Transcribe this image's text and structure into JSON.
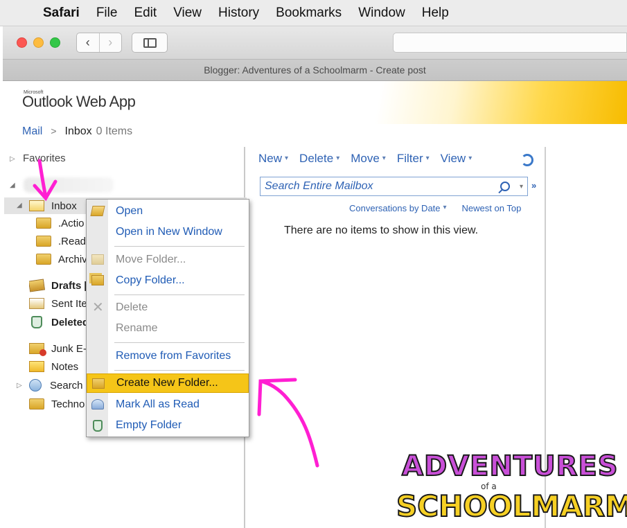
{
  "menubar": {
    "apple_icon": "apple-logo",
    "app": "Safari",
    "items": [
      "File",
      "Edit",
      "View",
      "History",
      "Bookmarks",
      "Window",
      "Help"
    ]
  },
  "browser": {
    "back_glyph": "‹",
    "forward_glyph": "›",
    "tab_title": "Blogger: Adventures of a Schoolmarm - Create post"
  },
  "owa": {
    "brand_small": "Microsoft",
    "title": "Outlook Web App",
    "header_gradient_color": "#f7bc00"
  },
  "breadcrumb": {
    "mail": "Mail",
    "separator": ">",
    "current": "Inbox",
    "count": "0 Items"
  },
  "navpane": {
    "favorites": "Favorites",
    "folders": [
      {
        "label": "Inbox",
        "icon": "inbox-icon"
      },
      {
        "label": ".Actio",
        "icon": "folder-icon"
      },
      {
        "label": ".Read",
        "icon": "folder-icon"
      },
      {
        "label": "Archiv",
        "icon": "folder-icon"
      },
      {
        "label": "Drafts [",
        "icon": "drafts-icon"
      },
      {
        "label": "Sent Ite",
        "icon": "sent-items-icon"
      },
      {
        "label": "Deleted",
        "icon": "deleted-items-icon"
      },
      {
        "label": "Junk E-",
        "icon": "junk-email-icon"
      },
      {
        "label": "Notes",
        "icon": "notes-icon"
      },
      {
        "label": "Search",
        "icon": "search-folder-icon"
      },
      {
        "label": "Techno",
        "icon": "folder-icon"
      }
    ]
  },
  "listpane": {
    "commands": [
      "New",
      "Delete",
      "Move",
      "Filter",
      "View"
    ],
    "search_placeholder": "Search Entire Mailbox",
    "sort_by": "Conversations by Date",
    "sort_order": "Newest on Top",
    "empty_message": "There are no items to show in this view."
  },
  "context_menu": {
    "items": [
      {
        "label": "Open",
        "enabled": true
      },
      {
        "label": "Open in New Window",
        "enabled": true
      },
      {
        "label": "Move Folder...",
        "enabled": false
      },
      {
        "label": "Copy Folder...",
        "enabled": true
      },
      {
        "label": "Delete",
        "enabled": false
      },
      {
        "label": "Rename",
        "enabled": false
      },
      {
        "label": "Remove from Favorites",
        "enabled": true
      },
      {
        "label": "Create New Folder...",
        "enabled": true,
        "highlighted": true
      },
      {
        "label": "Mark All as Read",
        "enabled": true
      },
      {
        "label": "Empty Folder",
        "enabled": true
      }
    ],
    "highlight_color": "#f5c518"
  },
  "annotations": {
    "arrow_color": "#ff1fd2"
  },
  "logo": {
    "line1": "ADVENTURES",
    "line2": "of a",
    "line3": "SCHOOLMARM"
  }
}
